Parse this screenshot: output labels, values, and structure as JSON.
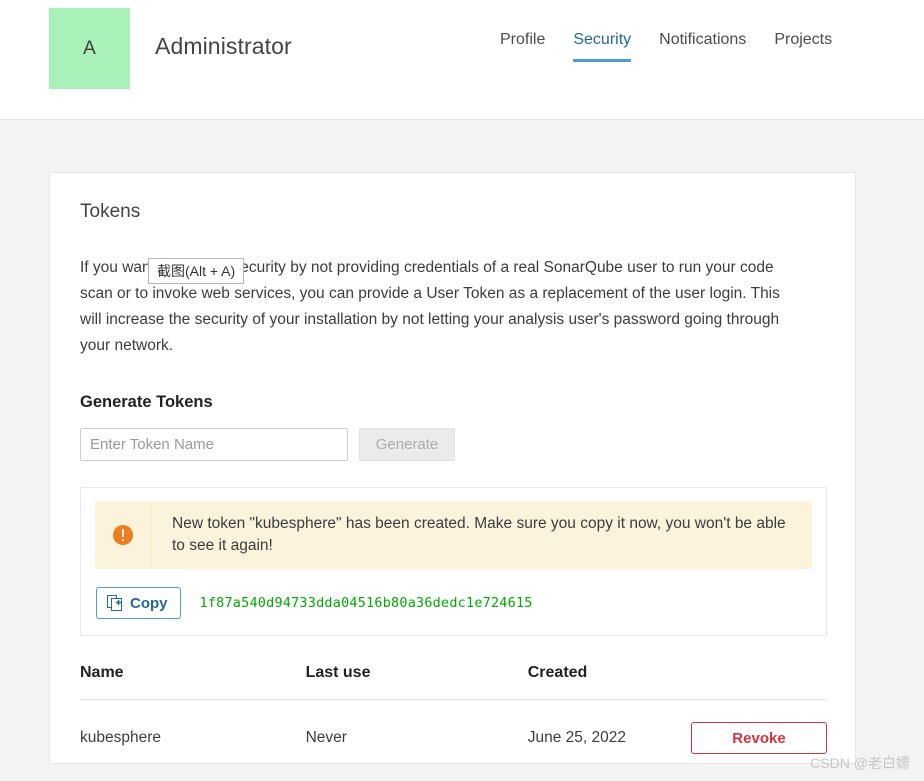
{
  "header": {
    "avatar_initial": "A",
    "user_name": "Administrator",
    "nav": [
      {
        "label": "Profile",
        "active": false
      },
      {
        "label": "Security",
        "active": true
      },
      {
        "label": "Notifications",
        "active": false
      },
      {
        "label": "Projects",
        "active": false
      }
    ]
  },
  "tokens_card": {
    "section_title": "Tokens",
    "intro": "If you want to enforce security by not providing credentials of a real SonarQube user to run your code scan or to invoke web services, you can provide a User Token as a replacement of the user login. This will increase the security of your installation by not letting your analysis user's password going through your network.",
    "generate": {
      "title": "Generate Tokens",
      "input_placeholder": "Enter Token Name",
      "input_value": "",
      "button_label": "Generate",
      "button_disabled": true
    },
    "alert": {
      "icon": "warning-circle-icon",
      "message": "New token \"kubesphere\" has been created. Make sure you copy it now, you won't be able to see it again!",
      "accent_color": "#ed7d1e",
      "background_color": "#fcf3dd"
    },
    "copy": {
      "button_label": "Copy",
      "icon": "copy-icon",
      "token_value": "1f87a540d94733dda04516b80a36dedc1e724615",
      "token_color": "#00aa00"
    },
    "table": {
      "columns": [
        "Name",
        "Last use",
        "Created",
        ""
      ],
      "rows": [
        {
          "name": "kubesphere",
          "last_use": "Never",
          "created": "June 25, 2022",
          "action_label": "Revoke",
          "action_color": "#d4333f"
        }
      ]
    }
  },
  "overlay": {
    "tooltip_text": "截图(Alt + A)"
  },
  "watermark": {
    "text": "CSDN @老白嫖"
  }
}
